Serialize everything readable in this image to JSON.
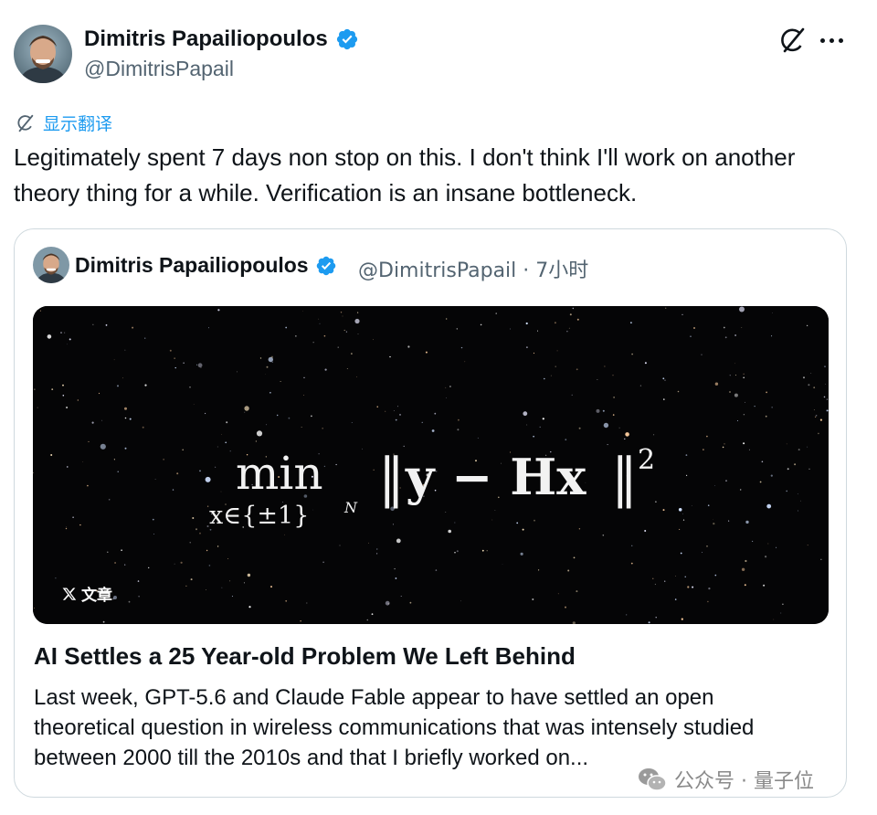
{
  "tweet": {
    "author_name": "Dimitris Papailiopoulos",
    "author_handle": "@DimitrisPapail",
    "translate_label": "显示翻译",
    "text": "Legitimately spent 7 days non stop on this. I don't think I'll work on another theory thing for a while. Verification is an insane bottleneck."
  },
  "quote": {
    "author_name": "Dimitris Papailiopoulos",
    "meta": "@DimitrisPapail · 7小时",
    "image": {
      "formula": {
        "op": "min",
        "sub": "x∈{±1}",
        "sub_sup": "N",
        "body_left": "‖",
        "body": "y − Hx",
        "body_right": "‖",
        "sup": "2"
      },
      "badge": "文章"
    },
    "article_title": "AI Settles a 25 Year-old Problem We Left Behind",
    "article_desc": "Last week, GPT-5.6 and Claude Fable appear to have settled an open theoretical question in wireless communications that was intensely studied between 2000 till the 2010s and that I briefly worked on..."
  },
  "watermark": {
    "text": "公众号 · 量子位"
  },
  "icons": {
    "verified": "verified-badge-icon",
    "grok": "grok-icon",
    "more": "more-icon",
    "translate": "grok-icon",
    "x_logo": "x-logo-icon",
    "wechat": "wechat-icon"
  },
  "colors": {
    "text": "#0f1419",
    "secondary": "#536471",
    "accent": "#1d9bf0",
    "border": "#cfd9de",
    "image_bg": "#050506"
  }
}
